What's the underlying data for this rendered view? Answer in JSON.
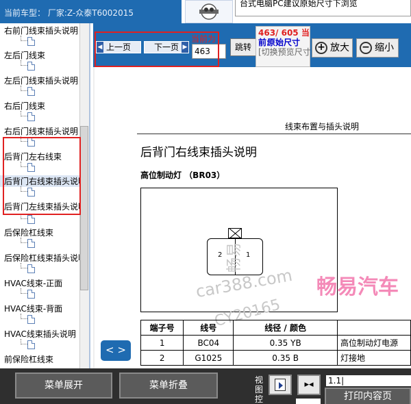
{
  "header": {
    "vehicle": "当前车型：  厂家:Z-众泰T6002015",
    "notice": "台式电脑PC建议原始尺寸下浏览"
  },
  "tree": {
    "items": [
      {
        "label": "右前门线束插头说明"
      },
      {
        "label": "左后门线束"
      },
      {
        "label": "左后门线束插头说明"
      },
      {
        "label": "右后门线束"
      },
      {
        "label": "右后门线束插头说明"
      },
      {
        "label": "后背门左右线束"
      },
      {
        "label": "后背门右线束插头说明",
        "selected": true
      },
      {
        "label": "后背门左线束插头说明"
      },
      {
        "label": "后保险杠线束"
      },
      {
        "label": "后保险杠线束插头说明"
      },
      {
        "label": "HVAC线束-正面"
      },
      {
        "label": "HVAC线束-背面"
      },
      {
        "label": "HVAC线束插头说明"
      },
      {
        "label": "前保险杠线束"
      }
    ]
  },
  "nav": {
    "prev_label": "上一页",
    "next_label": "下一页",
    "current_label": "当前为",
    "page_input_value": "463",
    "jump_label": "跳转",
    "page_count": "463/ 605 当",
    "current_short": "前:",
    "original_size": "原始尺寸",
    "switch_hint": "[切换预览尺寸]",
    "zoom_in_label": "放大",
    "zoom_out_label": "缩小"
  },
  "document": {
    "section_header": "线束布置与插头说明",
    "title": "后背门右线束插头说明",
    "connector_title": "高位制动灯  （BR03）",
    "pin_labels": [
      "2",
      "1"
    ],
    "watermarks": [
      "畅易",
      "car388.com",
      "CY20165"
    ],
    "brand_watermark": "畅易汽车",
    "table": {
      "headers": [
        "端子号",
        "线号",
        "线径 / 颜色",
        ""
      ],
      "rows": [
        [
          "1",
          "BC04",
          "0.35 YB",
          "高位制动灯电源"
        ],
        [
          "2",
          "G1025",
          "0.35 B",
          "灯接地"
        ]
      ]
    },
    "toggle_label": "< >"
  },
  "footer": {
    "expand_label": "菜单展开",
    "collapse_label": "菜单折叠",
    "view_label": "视图控",
    "page_field_value": "1.1|",
    "print_label": "打印内容页",
    "view_btn2_label": "▸◂"
  }
}
